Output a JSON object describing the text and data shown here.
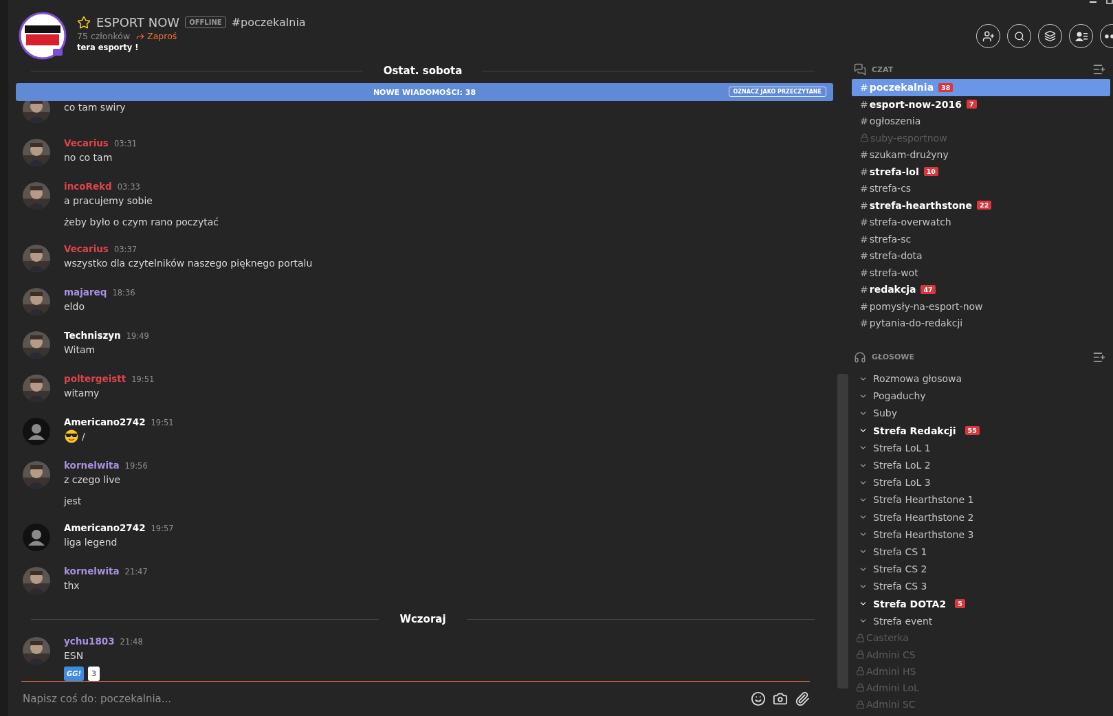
{
  "server": {
    "name": "ESPORT NOW",
    "status": "OFFLINE",
    "channel": "#poczekalnia",
    "members": "75 członków",
    "invite": "Zaproś",
    "topic": "tera esporty !"
  },
  "banner": {
    "text": "NOWE WIADOMOŚCI: 38",
    "button": "OZNACZ JAKO PRZECZYTANE"
  },
  "feed": [
    {
      "kind": "divider",
      "label": "Ostat. sobota"
    },
    {
      "kind": "message",
      "default_avatar": false,
      "lines": [
        "co tam swiry"
      ]
    },
    {
      "kind": "message",
      "default_avatar": false,
      "author": "Vecarius",
      "color": "#e0444b",
      "time": "03:31",
      "lines": [
        "no co tam"
      ]
    },
    {
      "kind": "message",
      "default_avatar": false,
      "author": "incoRekd",
      "color": "#e0444b",
      "time": "03:33",
      "lines": [
        "a pracujemy sobie",
        "żeby było o czym rano poczytać"
      ]
    },
    {
      "kind": "message",
      "default_avatar": false,
      "author": "Vecarius",
      "color": "#e0444b",
      "time": "03:37",
      "lines": [
        "wszystko dla czytelników naszego pięknego portalu"
      ]
    },
    {
      "kind": "message",
      "default_avatar": false,
      "author": "majareq",
      "color": "#a98fe0",
      "time": "18:36",
      "lines": [
        "eldo"
      ]
    },
    {
      "kind": "message",
      "default_avatar": false,
      "author": "Techniszyn",
      "color": "#ffffff",
      "time": "19:49",
      "lines": [
        "Witam"
      ]
    },
    {
      "kind": "message",
      "default_avatar": false,
      "author": "poltergeistt",
      "color": "#e0444b",
      "time": "19:51",
      "lines": [
        "witamy"
      ]
    },
    {
      "kind": "message",
      "default_avatar": true,
      "author": "Americano2742",
      "color": "#ffffff",
      "time": "19:51",
      "emoji": true,
      "lines": [
        "/"
      ]
    },
    {
      "kind": "message",
      "default_avatar": false,
      "author": "kornelwita",
      "color": "#a98fe0",
      "time": "19:56",
      "lines": [
        "z czego live",
        "jest"
      ]
    },
    {
      "kind": "message",
      "default_avatar": true,
      "author": "Americano2742",
      "color": "#ffffff",
      "time": "19:57",
      "lines": [
        "liga legend"
      ]
    },
    {
      "kind": "message",
      "default_avatar": false,
      "author": "kornelwita",
      "color": "#a98fe0",
      "time": "21:47",
      "lines": [
        "thx"
      ]
    },
    {
      "kind": "divider",
      "label": "Wczoraj"
    },
    {
      "kind": "message",
      "default_avatar": false,
      "author": "ychu1803",
      "color": "#a98fe0",
      "time": "21:48",
      "lines": [
        "ESN"
      ],
      "reactions": [
        {
          "label": "GG!",
          "count": "3"
        }
      ]
    }
  ],
  "input": {
    "placeholder": "Napisz coś do: poczekalnia..."
  },
  "text_section": {
    "title": "CZAT"
  },
  "text_channels": [
    {
      "name": "poczekalnia",
      "symbol": "#",
      "badge": "38",
      "unread": true,
      "locked": false,
      "selected": true
    },
    {
      "name": "esport-now-2016",
      "symbol": "#",
      "badge": "7",
      "unread": true,
      "locked": false,
      "selected": false
    },
    {
      "name": "ogłoszenia",
      "symbol": "#",
      "unread": false,
      "locked": false,
      "selected": false
    },
    {
      "name": "suby-esportnow",
      "unread": false,
      "locked": true,
      "selected": false
    },
    {
      "name": "szukam-drużyny",
      "symbol": "#",
      "unread": false,
      "locked": false,
      "selected": false
    },
    {
      "name": "strefa-lol",
      "symbol": "#",
      "badge": "10",
      "unread": true,
      "locked": false,
      "selected": false
    },
    {
      "name": "strefa-cs",
      "symbol": "#",
      "unread": false,
      "locked": false,
      "selected": false
    },
    {
      "name": "strefa-hearthstone",
      "symbol": "#",
      "badge": "22",
      "unread": true,
      "locked": false,
      "selected": false
    },
    {
      "name": "strefa-overwatch",
      "symbol": "#",
      "unread": false,
      "locked": false,
      "selected": false
    },
    {
      "name": "strefa-sc",
      "symbol": "#",
      "unread": false,
      "locked": false,
      "selected": false
    },
    {
      "name": "strefa-dota",
      "symbol": "#",
      "unread": false,
      "locked": false,
      "selected": false
    },
    {
      "name": "strefa-wot",
      "symbol": "#",
      "unread": false,
      "locked": false,
      "selected": false
    },
    {
      "name": "redakcja",
      "symbol": "#",
      "badge": "47",
      "unread": true,
      "locked": false,
      "selected": false
    },
    {
      "name": "pomysły-na-esport-now",
      "symbol": "#",
      "unread": false,
      "locked": false,
      "selected": false
    },
    {
      "name": "pytania-do-redakcji",
      "symbol": "#",
      "unread": false,
      "locked": false,
      "selected": false
    }
  ],
  "voice_section": {
    "title": "GŁOSOWE"
  },
  "voice_channels": [
    {
      "name": "Rozmowa głosowa",
      "unread": false,
      "locked": false
    },
    {
      "name": "Pogaduchy",
      "unread": false,
      "locked": false
    },
    {
      "name": "Suby",
      "unread": false,
      "locked": false
    },
    {
      "name": "Strefa Redakcji",
      "badge": "55",
      "unread": true,
      "locked": false
    },
    {
      "name": "Strefa LoL 1",
      "unread": false,
      "locked": false
    },
    {
      "name": "Strefa LoL 2",
      "unread": false,
      "locked": false
    },
    {
      "name": "Strefa LoL 3",
      "unread": false,
      "locked": false
    },
    {
      "name": "Strefa Hearthstone 1",
      "unread": false,
      "locked": false
    },
    {
      "name": "Strefa Hearthstone 2",
      "unread": false,
      "locked": false
    },
    {
      "name": "Strefa Hearthstone 3",
      "unread": false,
      "locked": false
    },
    {
      "name": "Strefa CS 1",
      "unread": false,
      "locked": false
    },
    {
      "name": "Strefa CS 2",
      "unread": false,
      "locked": false
    },
    {
      "name": "Strefa CS 3",
      "unread": false,
      "locked": false
    },
    {
      "name": "Strefa DOTA2",
      "badge": "5",
      "unread": true,
      "locked": false
    },
    {
      "name": "Strefa event",
      "unread": false,
      "locked": false
    },
    {
      "name": "Casterka",
      "unread": false,
      "locked": true
    },
    {
      "name": "Admini CS",
      "unread": false,
      "locked": true
    },
    {
      "name": "Admini HS",
      "unread": false,
      "locked": true
    },
    {
      "name": "Admini LoL",
      "unread": false,
      "locked": true
    },
    {
      "name": "Admini SC",
      "unread": false,
      "locked": true
    }
  ]
}
